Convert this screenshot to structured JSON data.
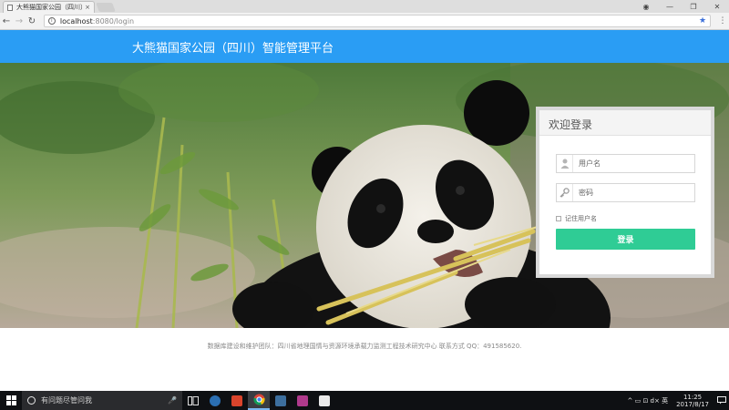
{
  "browser": {
    "tab_title": "大熊猫国家公园（四川）",
    "tab_close": "×",
    "window_controls": {
      "account": "◉",
      "minimize": "—",
      "restore": "❐",
      "close": "✕"
    },
    "back": "←",
    "forward": "→",
    "reload": "↻",
    "url_host": "localhost",
    "url_path": ":8080/login",
    "bookmark_star": "★",
    "menu": "⋮"
  },
  "header": {
    "title": "大熊猫国家公园（四川）智能管理平台",
    "bg_color": "#2a9df4"
  },
  "hero": {
    "image_subject": "giant panda eating bamboo"
  },
  "login": {
    "heading": "欢迎登录",
    "username_placeholder": "用户名",
    "password_placeholder": "密码",
    "remember_label": "记住用户名",
    "submit_label": "登录",
    "button_color": "#2fcc95"
  },
  "footer": {
    "text": "数据库建设和维护团队：四川省地理国情与资源环境承载力监测工程技术研究中心 联系方式 QQ：491585620."
  },
  "taskbar": {
    "search_placeholder": "有问题尽管问我",
    "tray_text": "^ ▭ ⊡ d× 英",
    "time": "11:25",
    "date": "2017/8/17"
  }
}
